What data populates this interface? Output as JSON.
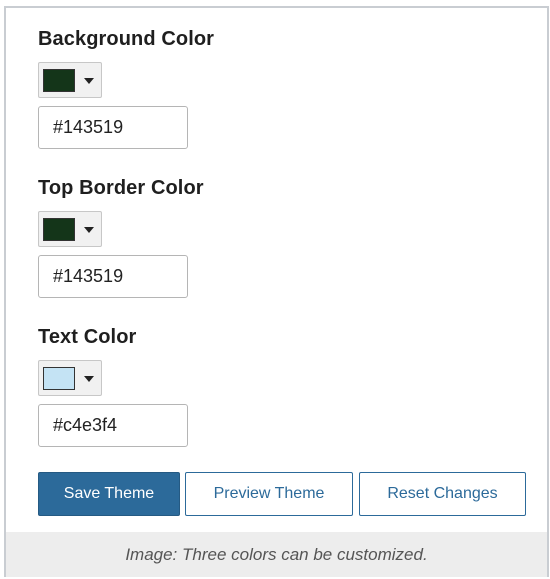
{
  "fields": [
    {
      "label": "Background Color",
      "swatch_color": "#143519",
      "value": "#143519"
    },
    {
      "label": "Top Border Color",
      "swatch_color": "#143519",
      "value": "#143519"
    },
    {
      "label": "Text Color",
      "swatch_color": "#c4e3f4",
      "value": "#c4e3f4"
    }
  ],
  "icons": {
    "dropdown": "chevron-down-icon"
  },
  "actions": {
    "save_label": "Save Theme",
    "preview_label": "Preview Theme",
    "reset_label": "Reset Changes"
  },
  "colors": {
    "primary": "#2c6a9a",
    "caption_bg": "#ededed"
  },
  "caption": "Image: Three colors can be customized."
}
